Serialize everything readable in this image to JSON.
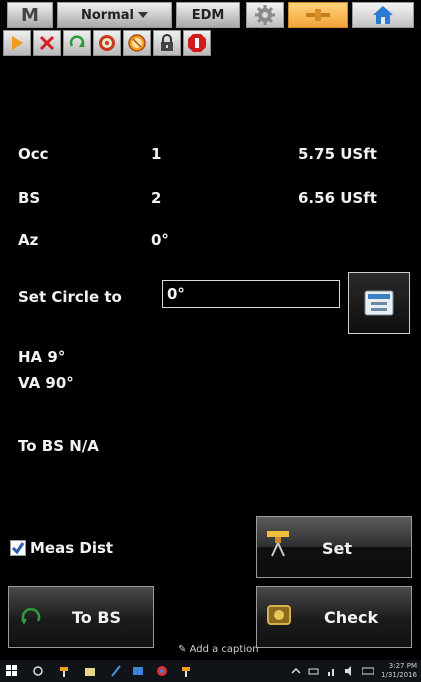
{
  "toolbar": {
    "mode_letter": "M",
    "mode_select": "Normal",
    "edm_label": "EDM",
    "icons": [
      "settings-gear-icon",
      "instrument-orange-icon",
      "home-icon"
    ]
  },
  "icon_row": [
    "play-arrow-icon",
    "target-icon",
    "rotate-icon",
    "prism-icon",
    "compass-icon",
    "lock-icon",
    "stop-icon"
  ],
  "fields": {
    "occ": {
      "label": "Occ",
      "point": "1",
      "height": "5.75 USft"
    },
    "bs": {
      "label": "BS",
      "point": "2",
      "height": "6.56 USft"
    },
    "az": {
      "label": "Az",
      "value": "0°"
    },
    "set_circle": {
      "label": "Set Circle to",
      "value": "0°"
    },
    "ha": "HA 9°",
    "va": "VA 90°",
    "to_bs": "To BS N/A"
  },
  "meas_dist": {
    "label": "Meas Dist",
    "checked": true
  },
  "buttons": {
    "set": "Set",
    "to_bs": "To BS",
    "check": "Check"
  },
  "caption": "Add a caption",
  "taskbar": {
    "time": "3:27 PM",
    "date": "1/31/2016"
  },
  "colors": {
    "background": "#000000",
    "accent_orange": "#f2a33a",
    "text": "#f2f2f2"
  }
}
